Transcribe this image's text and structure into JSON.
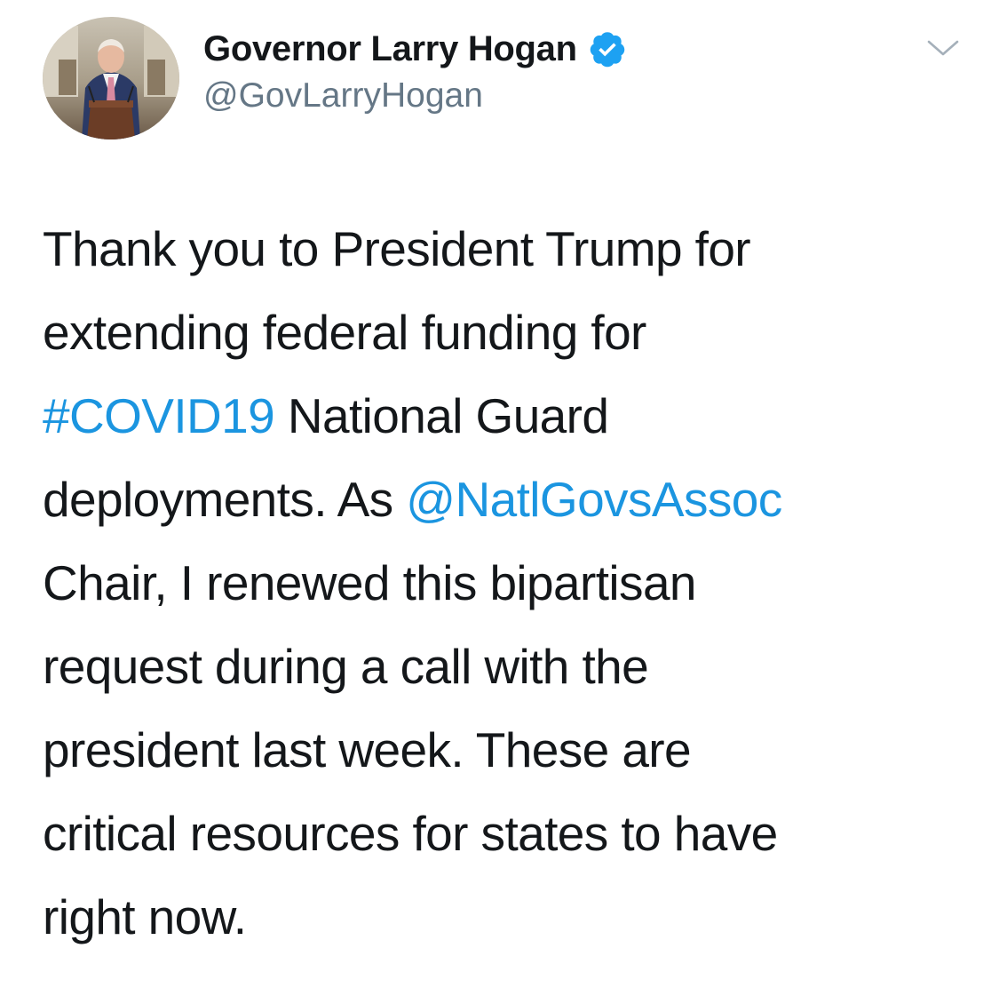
{
  "colors": {
    "text": "#14171a",
    "secondary_text": "#657786",
    "link": "#1b95e0",
    "verified_badge": "#1da1f2",
    "background": "#ffffff"
  },
  "user": {
    "display_name": "Governor Larry Hogan",
    "handle": "@GovLarryHogan",
    "verified": true,
    "avatar_description_icon": "profile-photo",
    "verified_icon": "verified-badge-icon"
  },
  "menu": {
    "icon": "chevron-down-icon"
  },
  "tweet": {
    "lines": [
      [
        {
          "text": "Thank you to President Trump for",
          "type": "text"
        }
      ],
      [
        {
          "text": "extending federal funding for",
          "type": "text"
        }
      ],
      [
        {
          "text": "#COVID19",
          "type": "hashtag"
        },
        {
          "text": " National Guard",
          "type": "text"
        }
      ],
      [
        {
          "text": "deployments. As ",
          "type": "text"
        },
        {
          "text": "@NatlGovsAssoc",
          "type": "mention"
        }
      ],
      [
        {
          "text": "Chair, I renewed this bipartisan",
          "type": "text"
        }
      ],
      [
        {
          "text": "request during a call with the",
          "type": "text"
        }
      ],
      [
        {
          "text": "president last week. These are",
          "type": "text"
        }
      ],
      [
        {
          "text": "critical resources for states to have",
          "type": "text"
        }
      ],
      [
        {
          "text": "right now.",
          "type": "text"
        }
      ]
    ]
  }
}
